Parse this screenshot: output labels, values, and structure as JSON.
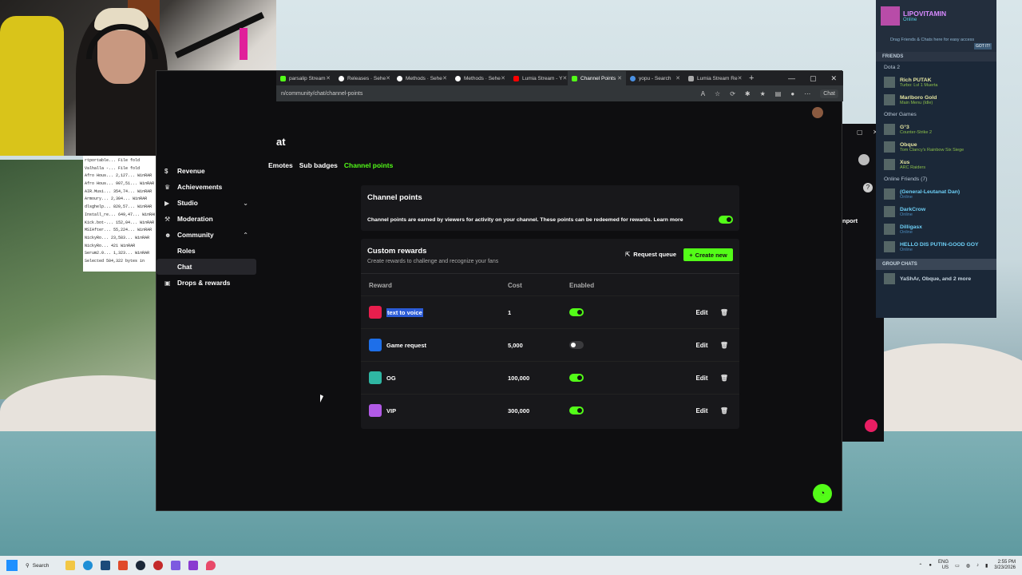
{
  "browser": {
    "tabs": [
      {
        "label": "parsalip Stream",
        "color": "#53fc18",
        "active": false
      },
      {
        "label": "Releases · Sehe",
        "color": "#ffffff",
        "active": false
      },
      {
        "label": "Methods · Sehe",
        "color": "#ffffff",
        "active": false
      },
      {
        "label": "Methods · Sehe",
        "color": "#ffffff",
        "active": false
      },
      {
        "label": "Lumia Stream - Y",
        "color": "#ff0000",
        "active": false
      },
      {
        "label": "Channel Points",
        "color": "#53fc18",
        "active": true
      },
      {
        "label": "yopu - Search",
        "color": "#4a90e2",
        "active": false
      },
      {
        "label": "Lumia Stream Re",
        "color": "#aaaaaa",
        "active": false
      }
    ],
    "url": "n/community/chat/channel-points",
    "chat_label": "Chat"
  },
  "sidebar": {
    "items": [
      {
        "label": "Revenue",
        "icon": "dollar-icon"
      },
      {
        "label": "Achievements",
        "icon": "trophy-icon"
      },
      {
        "label": "Studio",
        "icon": "video-icon"
      },
      {
        "label": "Moderation",
        "icon": "hammer-icon"
      },
      {
        "label": "Community",
        "icon": "people-icon"
      },
      {
        "label": "Roles"
      },
      {
        "label": "Chat"
      },
      {
        "label": "Drops & rewards",
        "icon": "gift-icon"
      }
    ]
  },
  "page": {
    "heading": "at",
    "subtabs": [
      "Emotes",
      "Sub badges",
      "Channel points"
    ],
    "points_card": {
      "title": "Channel points",
      "description": "Channel points are earned by viewers for activity on your channel. These points can be redeemed for rewards. Learn more",
      "enabled": true
    },
    "rewards_card": {
      "title": "Custom rewards",
      "subtitle": "Create rewards to challenge and recognize your fans",
      "request_queue_label": "Request queue",
      "create_new_label": "Create new",
      "columns": [
        "Reward",
        "Cost",
        "Enabled"
      ],
      "rows": [
        {
          "name": "text to voice",
          "cost": "1",
          "enabled": true,
          "color": "#e91e4d",
          "selected": true
        },
        {
          "name": "Game request",
          "cost": "5,000",
          "enabled": false,
          "color": "#1e6fe9",
          "selected": false
        },
        {
          "name": "OG",
          "cost": "100,000",
          "enabled": true,
          "color": "#2fb6a3",
          "selected": false
        },
        {
          "name": "VIP",
          "cost": "300,000",
          "enabled": true,
          "color": "#b15ae6",
          "selected": false
        }
      ],
      "edit_label": "Edit"
    },
    "accent": "#53fc18"
  },
  "bgwindow": {
    "partial_text": "nport"
  },
  "steam": {
    "profile_name": "LIPOVITAMIN",
    "profile_status": "Online",
    "drag_hint": "Drag Friends & Chats here for easy access",
    "got_it": "GOT IT!",
    "friends_header": "FRIENDS",
    "groups": [
      {
        "title": "Dota 2",
        "friends": [
          {
            "name": "Rich PUTAK",
            "status": "Turbo: Lvl 1 Muerta",
            "kind": "ing"
          },
          {
            "name": "Marlboro Gold",
            "status": "Main Menu (Idle)",
            "kind": "ing"
          }
        ]
      },
      {
        "title": "Other Games",
        "friends": [
          {
            "name": "G°3",
            "status": "Counter-Strike 2",
            "kind": "ing"
          },
          {
            "name": "Obque",
            "status": "Tom Clancy's Rainbow Six Siege",
            "kind": "ing"
          },
          {
            "name": "Xus",
            "status": "ARC Raiders",
            "kind": "ing"
          }
        ]
      },
      {
        "title": "Online Friends (7)",
        "friends": [
          {
            "name": "(General-Leutanat Dan)",
            "status": "Online",
            "kind": "onl"
          },
          {
            "name": "DarkCrow",
            "status": "Online",
            "kind": "onl"
          },
          {
            "name": "Dilligasx",
            "status": "Online",
            "kind": "onl"
          },
          {
            "name": "HELLO DIS PUTIN-GOOD GOY",
            "status": "Online",
            "kind": "onl"
          }
        ]
      }
    ],
    "group_chats_header": "GROUP CHATS",
    "group_chat": "YaShAr, Obque, and 2 more"
  },
  "winrar": {
    "rows": [
      {
        "name": "rtportable...",
        "type": "File fold"
      },
      {
        "name": "Valhalla -...",
        "type": "File fold"
      },
      {
        "name": "Afro Hous...",
        "size": "2,127...",
        "type": "WinRAR"
      },
      {
        "name": "Afro Hous...",
        "size": "907,51...",
        "type": "WinRAR"
      },
      {
        "name": "AIR.Musi...",
        "size": "354,74...",
        "type": "WinRAR"
      },
      {
        "name": "Armoury...",
        "size": "2,304...",
        "type": "WinRAR"
      },
      {
        "name": "dlsghelp...",
        "size": "820,57...",
        "type": "WinRAR"
      },
      {
        "name": "Install_re...",
        "size": "649,47...",
        "type": "WinRAR"
      },
      {
        "name": "Kick.bot-...",
        "size": "152,04...",
        "type": "WinRAR"
      },
      {
        "name": "MSIAfter...",
        "size": "55,224...",
        "type": "WinRAR"
      },
      {
        "name": "NickyRo...",
        "size": "23,583...",
        "type": "WinRAR"
      },
      {
        "name": "NickyRo...",
        "size": "421",
        "type": "WinRAR"
      },
      {
        "name": "Serum2.0...",
        "size": "1,323...",
        "type": "WinRAR"
      }
    ],
    "status": "Selected 504,322 bytes in"
  },
  "taskbar": {
    "search": "Search",
    "lang": "ENG",
    "region": "US",
    "time": "2:55 PM",
    "date": "3/23/2026"
  }
}
